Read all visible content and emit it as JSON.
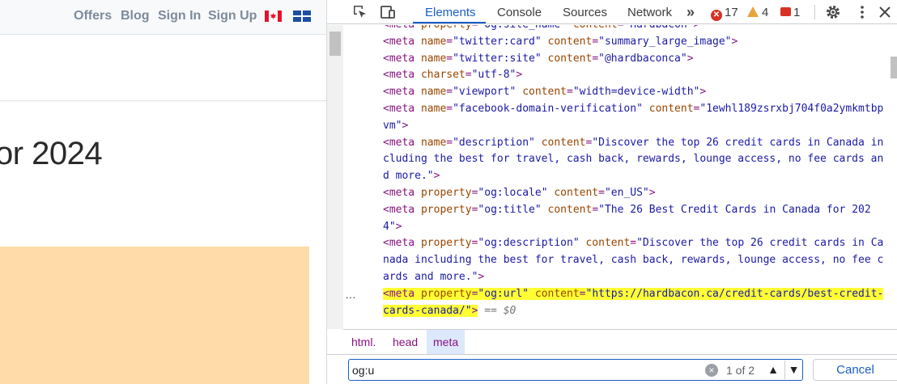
{
  "page": {
    "nav": {
      "offers": "Offers",
      "blog": "Blog",
      "sign_in": "Sign In",
      "sign_up": "Sign Up",
      "flag_icon": "canada-flag-icon",
      "flag_icon_2": "quebec-flag-icon"
    },
    "heading": "or 2024",
    "promo_color": "#fedba8"
  },
  "devtools": {
    "tabs": [
      {
        "label": "Elements",
        "active": true
      },
      {
        "label": "Console"
      },
      {
        "label": "Sources"
      },
      {
        "label": "Network"
      }
    ],
    "more_tabs": "»",
    "errors": "17",
    "warnings": "4",
    "issues": "1",
    "code_lines": [
      [
        {
          "c": "tag",
          "t": "<meta "
        },
        {
          "c": "an",
          "t": "property"
        },
        {
          "c": "tag",
          "t": "="
        },
        {
          "c": "av",
          "t": "\"og:site_name\" "
        },
        {
          "c": "an",
          "t": "content"
        },
        {
          "c": "tag",
          "t": "="
        },
        {
          "c": "av",
          "t": "\"Hardbacon\""
        },
        {
          "c": "tag",
          "t": ">"
        }
      ],
      [
        {
          "c": "tag",
          "t": "<meta "
        },
        {
          "c": "an",
          "t": "name"
        },
        {
          "c": "tag",
          "t": "="
        },
        {
          "c": "av",
          "t": "\"twitter:card\" "
        },
        {
          "c": "an",
          "t": "content"
        },
        {
          "c": "tag",
          "t": "="
        },
        {
          "c": "av",
          "t": "\"summary_large_image\""
        },
        {
          "c": "tag",
          "t": ">"
        }
      ],
      [
        {
          "c": "tag",
          "t": "<meta "
        },
        {
          "c": "an",
          "t": "name"
        },
        {
          "c": "tag",
          "t": "="
        },
        {
          "c": "av",
          "t": "\"twitter:site\" "
        },
        {
          "c": "an",
          "t": "content"
        },
        {
          "c": "tag",
          "t": "="
        },
        {
          "c": "av",
          "t": "\"@hardbaconca\""
        },
        {
          "c": "tag",
          "t": ">"
        }
      ],
      [
        {
          "c": "tag",
          "t": "<meta "
        },
        {
          "c": "an",
          "t": "charset"
        },
        {
          "c": "tag",
          "t": "="
        },
        {
          "c": "av",
          "t": "\"utf-8\""
        },
        {
          "c": "tag",
          "t": ">"
        }
      ],
      [
        {
          "c": "tag",
          "t": "<meta "
        },
        {
          "c": "an",
          "t": "name"
        },
        {
          "c": "tag",
          "t": "="
        },
        {
          "c": "av",
          "t": "\"viewport\" "
        },
        {
          "c": "an",
          "t": "content"
        },
        {
          "c": "tag",
          "t": "="
        },
        {
          "c": "av",
          "t": "\"width=device-width\""
        },
        {
          "c": "tag",
          "t": ">"
        }
      ],
      [
        {
          "c": "tag",
          "t": "<meta "
        },
        {
          "c": "an",
          "t": "name"
        },
        {
          "c": "tag",
          "t": "="
        },
        {
          "c": "av",
          "t": "\"facebook-domain-verification\" "
        },
        {
          "c": "an",
          "t": "content"
        },
        {
          "c": "tag",
          "t": "="
        },
        {
          "c": "av",
          "t": "\"1ewhl189zsrxbj704f0a2ymkmtbpvm\""
        },
        {
          "c": "tag",
          "t": ">"
        }
      ],
      [
        {
          "c": "tag",
          "t": "<meta "
        },
        {
          "c": "an",
          "t": "name"
        },
        {
          "c": "tag",
          "t": "="
        },
        {
          "c": "av",
          "t": "\"description\" "
        },
        {
          "c": "an",
          "t": "content"
        },
        {
          "c": "tag",
          "t": "="
        },
        {
          "c": "av",
          "t": "\"Discover the top 26 credit cards in Canada including the best for travel, cash back, rewards, lounge access, no fee cards and more.\""
        },
        {
          "c": "tag",
          "t": ">"
        }
      ],
      [
        {
          "c": "tag",
          "t": "<meta "
        },
        {
          "c": "an",
          "t": "property"
        },
        {
          "c": "tag",
          "t": "="
        },
        {
          "c": "av",
          "t": "\"og:locale\" "
        },
        {
          "c": "an",
          "t": "content"
        },
        {
          "c": "tag",
          "t": "="
        },
        {
          "c": "av",
          "t": "\"en_US\""
        },
        {
          "c": "tag",
          "t": ">"
        }
      ],
      [
        {
          "c": "tag",
          "t": "<meta "
        },
        {
          "c": "an",
          "t": "property"
        },
        {
          "c": "tag",
          "t": "="
        },
        {
          "c": "av",
          "t": "\"og:title\" "
        },
        {
          "c": "an",
          "t": "content"
        },
        {
          "c": "tag",
          "t": "="
        },
        {
          "c": "av",
          "t": "\"The 26 Best Credit Cards in Canada for 2024\""
        },
        {
          "c": "tag",
          "t": ">"
        }
      ],
      [
        {
          "c": "tag",
          "t": "<meta "
        },
        {
          "c": "an",
          "t": "property"
        },
        {
          "c": "tag",
          "t": "="
        },
        {
          "c": "av",
          "t": "\"og:description\" "
        },
        {
          "c": "an",
          "t": "content"
        },
        {
          "c": "tag",
          "t": "="
        },
        {
          "c": "av",
          "t": "\"Discover the top 26 credit cards in Canada including the best for travel, cash back, rewards, lounge access, no fee cards and more.\""
        },
        {
          "c": "tag",
          "t": ">"
        }
      ],
      [
        {
          "c": "tag hl",
          "t": "<meta "
        },
        {
          "c": "an hl",
          "t": "property"
        },
        {
          "c": "tag hl",
          "t": "="
        },
        {
          "c": "av hl",
          "t": "\"og:url\" "
        },
        {
          "c": "an hl",
          "t": "content"
        },
        {
          "c": "tag hl",
          "t": "="
        },
        {
          "c": "av hl",
          "t": "\"https://hardbacon.ca/credit-cards/best-credit-cards-canada/\""
        },
        {
          "c": "tag hl",
          "t": ">"
        },
        {
          "c": "dollar",
          "t": " == $0"
        }
      ]
    ],
    "selected_line": 10,
    "ellipsis": "…",
    "breadcrumb": [
      "html.",
      "head",
      "meta"
    ],
    "search": {
      "value": "og:u",
      "match_count": "1 of 2",
      "prev": "▲",
      "next": "▼",
      "cancel": "Cancel",
      "clear": "×"
    },
    "accent": "#1a5ec7",
    "highlight": "#ffff33"
  }
}
